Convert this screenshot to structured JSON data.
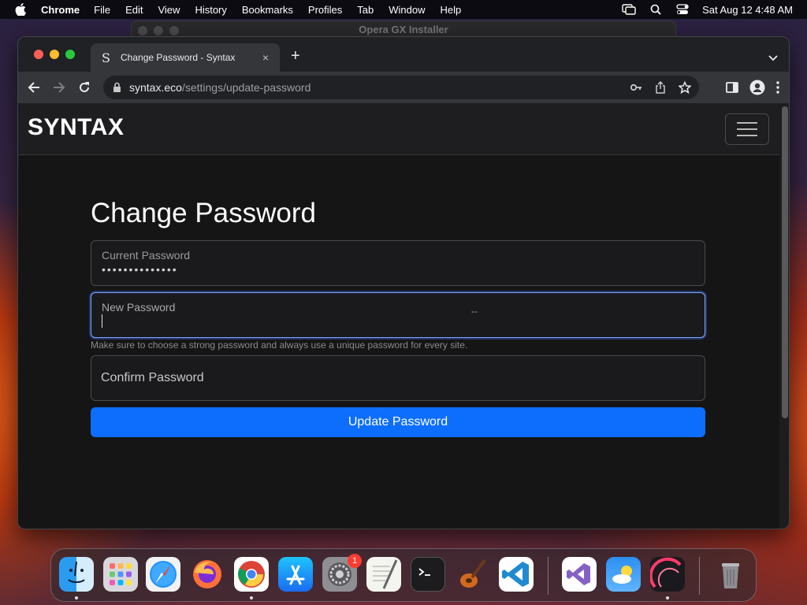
{
  "menubar": {
    "app_name": "Chrome",
    "items": [
      "File",
      "Edit",
      "View",
      "History",
      "Bookmarks",
      "Profiles",
      "Tab",
      "Window",
      "Help"
    ],
    "clock": "Sat Aug 12  4:48 AM"
  },
  "background_window": {
    "title": "Opera GX Installer"
  },
  "browser": {
    "tab": {
      "favicon": "S",
      "title": "Change Password - Syntax",
      "close": "×"
    },
    "new_tab": "+",
    "url": {
      "host": "syntax.eco",
      "path": "/settings/update-password"
    }
  },
  "page": {
    "brand": "SYNTAX",
    "heading": "Change Password",
    "current_password": {
      "label": "Current Password",
      "value": "••••••••••••••"
    },
    "new_password": {
      "label": "New Password",
      "value": "",
      "marker": "--"
    },
    "help_text": "Make sure to choose a strong password and always use a unique password for every site.",
    "confirm_password": {
      "placeholder": "Confirm Password"
    },
    "submit": "Update Password"
  },
  "dock": {
    "apps": [
      "finder",
      "launchpad",
      "safari",
      "firefox",
      "chrome",
      "app-store",
      "system-settings",
      "textedit",
      "terminal",
      "garageband",
      "vscode",
      "visual-studio",
      "weather",
      "activity-monitor",
      "trash"
    ],
    "system_settings_badge": "1"
  },
  "colors": {
    "accent": "#0d6efd",
    "page_bg": "#151516",
    "focus_ring": "#7da6ff"
  }
}
